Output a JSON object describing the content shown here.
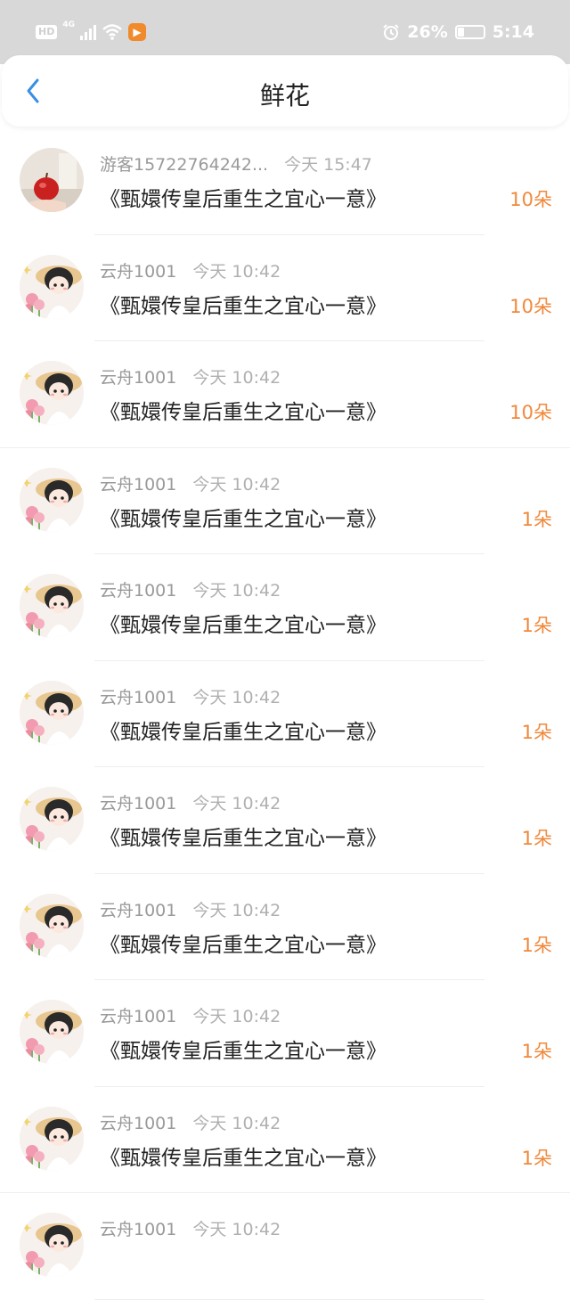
{
  "status": {
    "hd": "HD",
    "net": "4G",
    "battery_pct": "26%",
    "battery_level": 0.26,
    "time": "5:14",
    "icons": [
      "hd-icon",
      "signal-icon",
      "wifi-icon",
      "app-badge-icon",
      "alarm-icon",
      "battery-icon"
    ]
  },
  "header": {
    "title": "鲜花",
    "back_icon": "chevron-left-icon"
  },
  "colors": {
    "accent": "#3a8ee6",
    "count": "#f0883a"
  },
  "items": [
    {
      "user": "游客15722764242...",
      "time": "今天 15:47",
      "book": "《甄嬛传皇后重生之宜心一意》",
      "count": "10朵",
      "avatar": "apple-photo"
    },
    {
      "user": "云舟1001",
      "time": "今天 10:42",
      "book": "《甄嬛传皇后重生之宜心一意》",
      "count": "10朵",
      "avatar": "anime-girl"
    },
    {
      "user": "云舟1001",
      "time": "今天 10:42",
      "book": "《甄嬛传皇后重生之宜心一意》",
      "count": "10朵",
      "avatar": "anime-girl"
    },
    {
      "user": "云舟1001",
      "time": "今天 10:42",
      "book": "《甄嬛传皇后重生之宜心一意》",
      "count": "1朵",
      "avatar": "anime-girl"
    },
    {
      "user": "云舟1001",
      "time": "今天 10:42",
      "book": "《甄嬛传皇后重生之宜心一意》",
      "count": "1朵",
      "avatar": "anime-girl"
    },
    {
      "user": "云舟1001",
      "time": "今天 10:42",
      "book": "《甄嬛传皇后重生之宜心一意》",
      "count": "1朵",
      "avatar": "anime-girl"
    },
    {
      "user": "云舟1001",
      "time": "今天 10:42",
      "book": "《甄嬛传皇后重生之宜心一意》",
      "count": "1朵",
      "avatar": "anime-girl"
    },
    {
      "user": "云舟1001",
      "time": "今天 10:42",
      "book": "《甄嬛传皇后重生之宜心一意》",
      "count": "1朵",
      "avatar": "anime-girl"
    },
    {
      "user": "云舟1001",
      "time": "今天 10:42",
      "book": "《甄嬛传皇后重生之宜心一意》",
      "count": "1朵",
      "avatar": "anime-girl"
    },
    {
      "user": "云舟1001",
      "time": "今天 10:42",
      "book": "《甄嬛传皇后重生之宜心一意》",
      "count": "1朵",
      "avatar": "anime-girl"
    },
    {
      "user": "云舟1001",
      "time": "今天 10:42",
      "book": "",
      "count": "",
      "avatar": "anime-girl"
    }
  ]
}
